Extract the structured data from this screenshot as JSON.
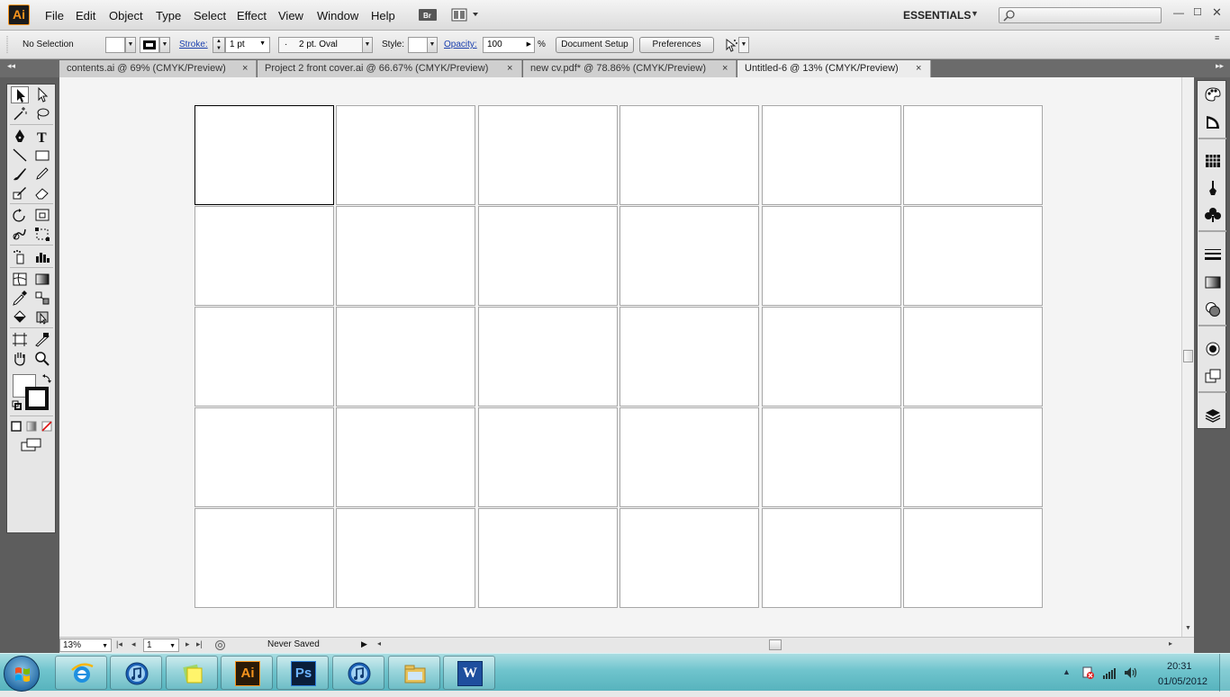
{
  "app": {
    "logo": "Ai"
  },
  "menu": {
    "items": [
      "File",
      "Edit",
      "Object",
      "Type",
      "Select",
      "Effect",
      "View",
      "Window",
      "Help"
    ],
    "bridge_icon": "bridge-icon",
    "arrange_icon": "arrange-documents-icon",
    "workspace": "ESSENTIALS",
    "search_placeholder": ""
  },
  "control_bar": {
    "selection": "No Selection",
    "stroke_label": "Stroke:",
    "stroke_weight": "1 pt",
    "brush_bullet": "·",
    "brush": "2 pt. Oval",
    "style_label": "Style:",
    "opacity_label": "Opacity:",
    "opacity_value": "100",
    "opacity_unit": "%",
    "document_setup": "Document Setup",
    "preferences": "Preferences"
  },
  "tabs": [
    {
      "label": "contents.ai @ 69% (CMYK/Preview)",
      "active": false
    },
    {
      "label": "Project 2 front cover.ai @ 66.67% (CMYK/Preview)",
      "active": false
    },
    {
      "label": "new cv.pdf* @ 78.86% (CMYK/Preview)",
      "active": false
    },
    {
      "label": "Untitled-6 @ 13% (CMYK/Preview)",
      "active": true
    }
  ],
  "tab_close": "×",
  "canvas": {
    "artboard_rows": 5,
    "artboard_cols": 6,
    "selected_artboard": 1
  },
  "status_bar": {
    "zoom": "13%",
    "artboard_number": "1",
    "status_text": "Never Saved"
  },
  "taskbar": {
    "apps": [
      {
        "name": "internet-explorer-icon"
      },
      {
        "name": "itunes-icon"
      },
      {
        "name": "sticky-notes-icon"
      },
      {
        "name": "illustrator-icon",
        "label": "Ai"
      },
      {
        "name": "photoshop-icon",
        "label": "Ps"
      },
      {
        "name": "itunes-icon-2"
      },
      {
        "name": "explorer-icon"
      },
      {
        "name": "word-icon",
        "label": "W"
      }
    ],
    "time": "20:31",
    "date": "01/05/2012"
  },
  "colors": {
    "ai_orange": "#f7941d",
    "ps_blue": "#2b7bd6",
    "taskbar": "#6fc4cd"
  }
}
